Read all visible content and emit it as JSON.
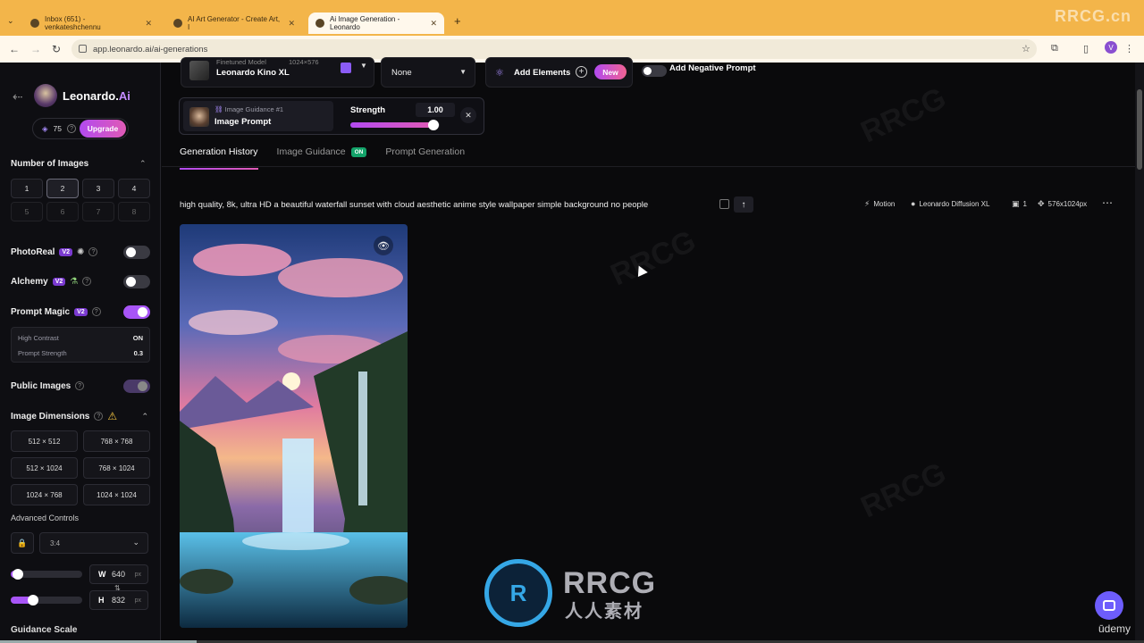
{
  "browser": {
    "tabs": [
      {
        "title": "Inbox (651) - venkateshchennu"
      },
      {
        "title": "AI Art Generator - Create Art, I"
      },
      {
        "title": "Ai Image Generation - Leonardo"
      }
    ],
    "new_tab": "+",
    "url": "app.leonardo.ai/ai-generations",
    "profile_initial": "V",
    "watermark": "RRCG.cn"
  },
  "sidebar": {
    "brand_main": "Leonardo.",
    "brand_ai": "Ai",
    "tokens": "75",
    "upgrade": "Upgrade",
    "number_of_images": {
      "title": "Number of Images",
      "options": [
        "1",
        "2",
        "3",
        "4",
        "5",
        "6",
        "7",
        "8"
      ],
      "selected": "2"
    },
    "photoreal": {
      "label": "PhotoReal",
      "badge": "V2",
      "enabled": false
    },
    "alchemy": {
      "label": "Alchemy",
      "badge": "V2",
      "enabled": false
    },
    "prompt_magic": {
      "label": "Prompt Magic",
      "badge": "V2",
      "enabled": true,
      "high_contrast_label": "High Contrast",
      "high_contrast_value": "ON",
      "prompt_strength_label": "Prompt Strength",
      "prompt_strength_value": "0.3"
    },
    "public_images": {
      "label": "Public Images",
      "enabled": true
    },
    "image_dimensions": {
      "title": "Image Dimensions",
      "options": [
        "512 × 512",
        "768 × 768",
        "512 × 1024",
        "768 × 1024",
        "1024 × 768",
        "1024 × 1024"
      ]
    },
    "advanced_controls": "Advanced Controls",
    "aspect_ratio": "3:4",
    "width_label": "W",
    "width_value": "640",
    "height_label": "H",
    "height_value": "832",
    "unit": "px",
    "guidance_scale": "Guidance Scale"
  },
  "toolbar": {
    "model_sublabel": "Finetuned Model",
    "model_resolution": "1024×576",
    "model_name": "Leonardo Kino XL",
    "preset": "None",
    "add_elements": "Add Elements",
    "new_badge": "New",
    "add_negative_prompt": "Add Negative Prompt",
    "image_guidance_sub": "Image Guidance #1",
    "image_prompt": "Image Prompt",
    "strength_label": "Strength",
    "strength_value": "1.00",
    "strength_fraction": 0.93
  },
  "tabs": {
    "generation_history": "Generation History",
    "image_guidance": "Image Guidance",
    "image_guidance_badge": "ON",
    "prompt_generation": "Prompt Generation"
  },
  "generation": {
    "prompt": "high quality, 8k, ultra HD a beautiful waterfall sunset with cloud aesthetic anime style wallpaper simple background no people",
    "meta_motion": "Motion",
    "meta_model": "Leonardo Diffusion XL",
    "meta_count": "1",
    "meta_size": "576x1024px"
  },
  "footer": {
    "udemy": "ūdemy",
    "wm_text": "RRCG",
    "wm_sub": "人人素材"
  }
}
